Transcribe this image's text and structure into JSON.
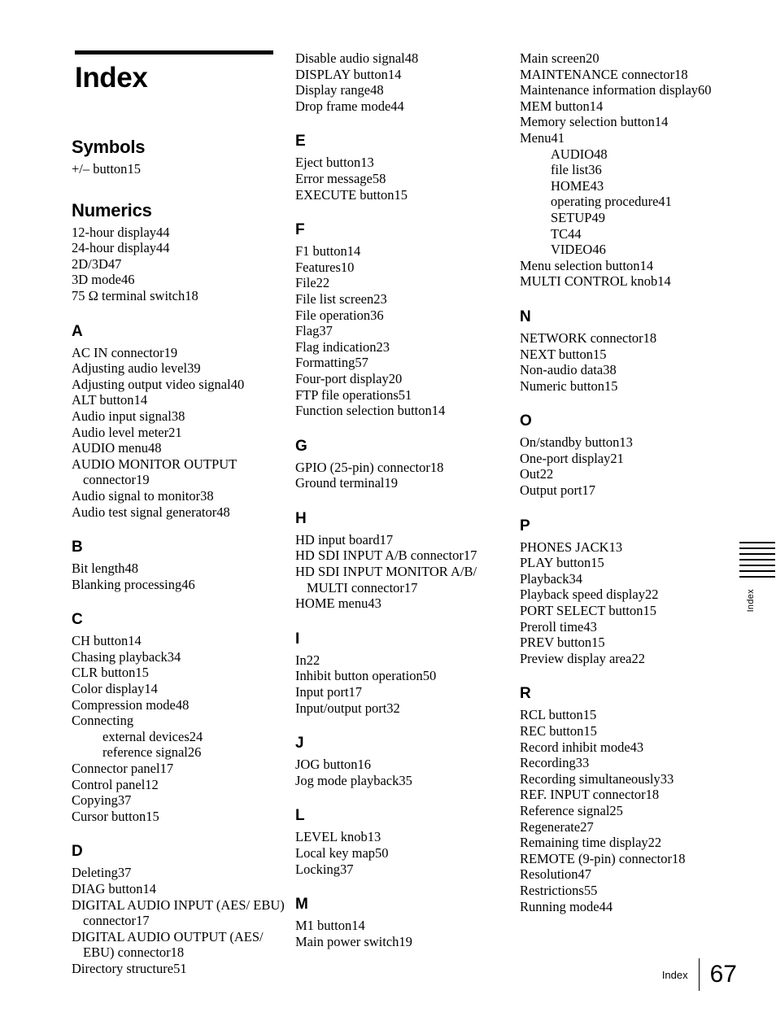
{
  "document": {
    "title": "Index",
    "footer_label": "Index",
    "page_number": "67",
    "side_tab_label": "Index",
    "side_tab_bars": 7
  },
  "columns": [
    {
      "id": "column-1",
      "sections": [
        {
          "heading": "Symbols",
          "style": "big",
          "entries": [
            {
              "text": "+/– button",
              "page": "15"
            }
          ]
        },
        {
          "heading": "Numerics",
          "style": "big",
          "entries": [
            {
              "text": "12-hour display",
              "page": "44"
            },
            {
              "text": "24-hour display",
              "page": "44"
            },
            {
              "text": "2D/3D",
              "page": "47"
            },
            {
              "text": "3D mode",
              "page": "46"
            },
            {
              "text": "75 Ω terminal switch",
              "page": "18"
            }
          ]
        },
        {
          "heading": "A",
          "style": "letter",
          "entries": [
            {
              "text": "AC IN connector",
              "page": "19"
            },
            {
              "text": "Adjusting audio level",
              "page": "39"
            },
            {
              "text": "Adjusting output video signal",
              "page": "40"
            },
            {
              "text": "ALT button",
              "page": "14"
            },
            {
              "text": "Audio input signal",
              "page": "38"
            },
            {
              "text": "Audio level meter",
              "page": "21"
            },
            {
              "text": "AUDIO menu",
              "page": "48"
            },
            {
              "text": "AUDIO MONITOR OUTPUT connector",
              "page": "19"
            },
            {
              "text": "Audio signal to monitor",
              "page": "38"
            },
            {
              "text": "Audio test signal generator",
              "page": "48"
            }
          ]
        },
        {
          "heading": "B",
          "style": "letter",
          "entries": [
            {
              "text": "Bit length",
              "page": "48"
            },
            {
              "text": "Blanking processing",
              "page": "46"
            }
          ]
        },
        {
          "heading": "C",
          "style": "letter",
          "entries": [
            {
              "text": "CH button",
              "page": "14"
            },
            {
              "text": "Chasing playback",
              "page": "34"
            },
            {
              "text": "CLR button",
              "page": "15"
            },
            {
              "text": "Color display",
              "page": "14"
            },
            {
              "text": "Compression mode",
              "page": "48"
            },
            {
              "text": "Connecting",
              "page": ""
            },
            {
              "text": "external devices",
              "page": "24",
              "sub": true
            },
            {
              "text": "reference signal",
              "page": "26",
              "sub": true
            },
            {
              "text": "Connector panel",
              "page": "17"
            },
            {
              "text": "Control panel",
              "page": "12"
            },
            {
              "text": "Copying",
              "page": "37"
            },
            {
              "text": "Cursor button",
              "page": "15"
            }
          ]
        },
        {
          "heading": "D",
          "style": "letter",
          "entries": [
            {
              "text": "Deleting",
              "page": "37"
            },
            {
              "text": "DIAG button",
              "page": "14"
            },
            {
              "text": "DIGITAL AUDIO INPUT (AES/ EBU) connector",
              "page": "17"
            },
            {
              "text": "DIGITAL AUDIO OUTPUT (AES/ EBU) connector",
              "page": "18"
            },
            {
              "text": "Directory structure",
              "page": "51"
            }
          ]
        }
      ]
    },
    {
      "id": "column-2",
      "sections": [
        {
          "heading": "",
          "style": "none",
          "entries": [
            {
              "text": "Disable audio signal",
              "page": "48"
            },
            {
              "text": "DISPLAY button",
              "page": "14"
            },
            {
              "text": "Display range",
              "page": "48"
            },
            {
              "text": "Drop frame mode",
              "page": "44"
            }
          ]
        },
        {
          "heading": "E",
          "style": "letter",
          "entries": [
            {
              "text": "Eject button",
              "page": "13"
            },
            {
              "text": "Error message",
              "page": "58"
            },
            {
              "text": "EXECUTE button",
              "page": "15"
            }
          ]
        },
        {
          "heading": "F",
          "style": "letter",
          "entries": [
            {
              "text": "F1 button",
              "page": "14"
            },
            {
              "text": "Features",
              "page": "10"
            },
            {
              "text": "File",
              "page": "22"
            },
            {
              "text": "File list screen",
              "page": "23"
            },
            {
              "text": "File operation",
              "page": "36"
            },
            {
              "text": "Flag",
              "page": "37"
            },
            {
              "text": "Flag indication",
              "page": "23"
            },
            {
              "text": "Formatting",
              "page": "57"
            },
            {
              "text": "Four-port display",
              "page": "20"
            },
            {
              "text": "FTP file operations",
              "page": "51"
            },
            {
              "text": "Function selection button",
              "page": "14"
            }
          ]
        },
        {
          "heading": "G",
          "style": "letter",
          "entries": [
            {
              "text": "GPIO (25-pin) connector",
              "page": "18"
            },
            {
              "text": "Ground terminal",
              "page": "19"
            }
          ]
        },
        {
          "heading": "H",
          "style": "letter",
          "entries": [
            {
              "text": "HD input board",
              "page": "17"
            },
            {
              "text": "HD SDI INPUT A/B connector",
              "page": "17"
            },
            {
              "text": "HD SDI INPUT MONITOR A/B/ MULTI connector",
              "page": "17"
            },
            {
              "text": "HOME menu",
              "page": "43"
            }
          ]
        },
        {
          "heading": "I",
          "style": "letter",
          "entries": [
            {
              "text": "In",
              "page": "22"
            },
            {
              "text": "Inhibit button operation",
              "page": "50"
            },
            {
              "text": "Input port",
              "page": "17"
            },
            {
              "text": "Input/output port",
              "page": "32"
            }
          ]
        },
        {
          "heading": "J",
          "style": "letter",
          "entries": [
            {
              "text": "JOG button",
              "page": "16"
            },
            {
              "text": "Jog mode playback",
              "page": "35"
            }
          ]
        },
        {
          "heading": "L",
          "style": "letter",
          "entries": [
            {
              "text": "LEVEL knob",
              "page": "13"
            },
            {
              "text": "Local key map",
              "page": "50"
            },
            {
              "text": "Locking",
              "page": "37"
            }
          ]
        },
        {
          "heading": "M",
          "style": "letter",
          "entries": [
            {
              "text": "M1 button",
              "page": "14"
            },
            {
              "text": "Main power switch",
              "page": "19"
            }
          ]
        }
      ]
    },
    {
      "id": "column-3",
      "sections": [
        {
          "heading": "",
          "style": "none",
          "entries": [
            {
              "text": "Main screen",
              "page": "20"
            },
            {
              "text": "MAINTENANCE connector",
              "page": "18"
            },
            {
              "text": "Maintenance information display",
              "page": "60"
            },
            {
              "text": "MEM button",
              "page": "14"
            },
            {
              "text": "Memory selection button",
              "page": "14"
            },
            {
              "text": "Menu",
              "page": "41"
            },
            {
              "text": "AUDIO",
              "page": "48",
              "sub": true
            },
            {
              "text": "file list",
              "page": "36",
              "sub": true
            },
            {
              "text": "HOME",
              "page": "43",
              "sub": true
            },
            {
              "text": "operating procedure",
              "page": "41",
              "sub": true
            },
            {
              "text": "SETUP",
              "page": "49",
              "sub": true
            },
            {
              "text": "TC",
              "page": "44",
              "sub": true
            },
            {
              "text": "VIDEO",
              "page": "46",
              "sub": true
            },
            {
              "text": "Menu selection button",
              "page": "14"
            },
            {
              "text": "MULTI CONTROL knob",
              "page": "14"
            }
          ]
        },
        {
          "heading": "N",
          "style": "letter",
          "entries": [
            {
              "text": "NETWORK connector",
              "page": "18"
            },
            {
              "text": "NEXT button",
              "page": "15"
            },
            {
              "text": "Non-audio data",
              "page": "38"
            },
            {
              "text": "Numeric button",
              "page": "15"
            }
          ]
        },
        {
          "heading": "O",
          "style": "letter",
          "entries": [
            {
              "text": "On/standby button",
              "page": "13"
            },
            {
              "text": "One-port display",
              "page": "21"
            },
            {
              "text": "Out",
              "page": "22"
            },
            {
              "text": "Output port",
              "page": "17"
            }
          ]
        },
        {
          "heading": "P",
          "style": "letter",
          "entries": [
            {
              "text": "PHONES JACK",
              "page": "13"
            },
            {
              "text": "PLAY button",
              "page": "15"
            },
            {
              "text": "Playback",
              "page": "34"
            },
            {
              "text": "Playback speed display",
              "page": "22"
            },
            {
              "text": "PORT SELECT button",
              "page": "15"
            },
            {
              "text": "Preroll time",
              "page": "43"
            },
            {
              "text": "PREV button",
              "page": "15"
            },
            {
              "text": "Preview display area",
              "page": "22"
            }
          ]
        },
        {
          "heading": "R",
          "style": "letter",
          "entries": [
            {
              "text": "RCL button",
              "page": "15"
            },
            {
              "text": "REC button",
              "page": "15"
            },
            {
              "text": "Record inhibit mode",
              "page": "43"
            },
            {
              "text": "Recording",
              "page": "33"
            },
            {
              "text": "Recording simultaneously",
              "page": "33"
            },
            {
              "text": "REF. INPUT connector",
              "page": "18"
            },
            {
              "text": "Reference signal",
              "page": "25"
            },
            {
              "text": "Regenerate",
              "page": "27"
            },
            {
              "text": "Remaining time display",
              "page": "22"
            },
            {
              "text": "REMOTE (9-pin) connector",
              "page": "18"
            },
            {
              "text": "Resolution",
              "page": "47"
            },
            {
              "text": "Restrictions",
              "page": "55"
            },
            {
              "text": "Running mode",
              "page": "44"
            }
          ]
        }
      ]
    }
  ]
}
